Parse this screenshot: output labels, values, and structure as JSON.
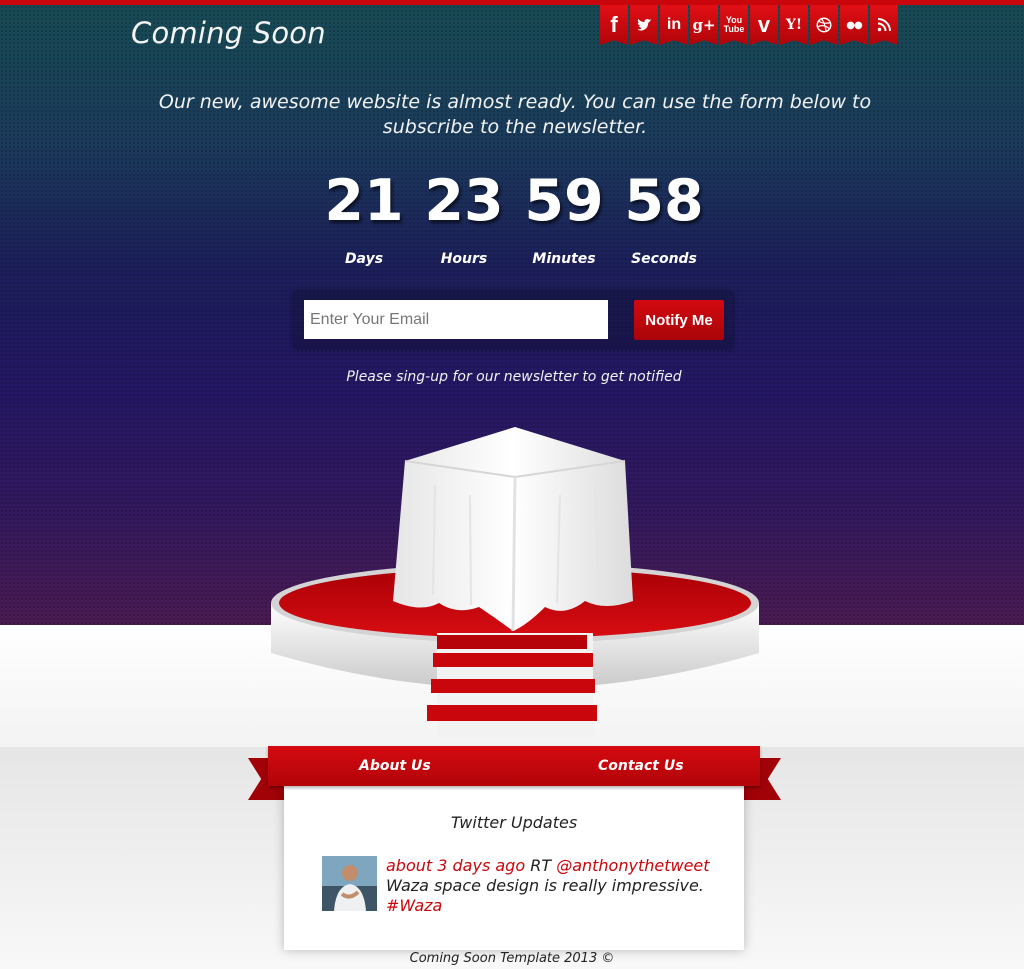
{
  "header": {
    "title": "Coming Soon",
    "social": [
      {
        "icon": "facebook-icon",
        "glyph": "f"
      },
      {
        "icon": "twitter-icon",
        "glyph": ""
      },
      {
        "icon": "linkedin-icon",
        "glyph": "in"
      },
      {
        "icon": "google-plus-icon",
        "glyph": "g+"
      },
      {
        "icon": "youtube-icon",
        "glyph": "You Tube"
      },
      {
        "icon": "vimeo-icon",
        "glyph": "v"
      },
      {
        "icon": "yahoo-icon",
        "glyph": "Y!"
      },
      {
        "icon": "dribbble-icon",
        "glyph": ""
      },
      {
        "icon": "flickr-icon",
        "glyph": "●●"
      },
      {
        "icon": "rss-icon",
        "glyph": ""
      }
    ]
  },
  "tagline": "Our new, awesome website is almost ready. You can use the form below to subscribe to the newsletter.",
  "countdown": {
    "days": "21",
    "days_label": "Days",
    "hours": "23",
    "hours_label": "Hours",
    "minutes": "59",
    "minutes_label": "Minutes",
    "seconds": "58",
    "seconds_label": "Seconds"
  },
  "subscribe": {
    "placeholder": "Enter Your Email",
    "value": "",
    "button": "Notify Me",
    "note": "Please sing-up for our newsletter to get notified"
  },
  "nav": {
    "about": "About Us",
    "contact": "Contact Us"
  },
  "twitter": {
    "title": "Twitter Updates",
    "time": "about 3 days ago",
    "rt": " RT ",
    "handle": "@anthonythetweet",
    "text": "Waza space design is really impressive.",
    "hashtag": "#Waza"
  },
  "footer": "Coming Soon Template 2013 ©",
  "colors": {
    "accent": "#c8060c",
    "hero_top": "#174b54",
    "hero_bottom": "#4a1b52"
  }
}
